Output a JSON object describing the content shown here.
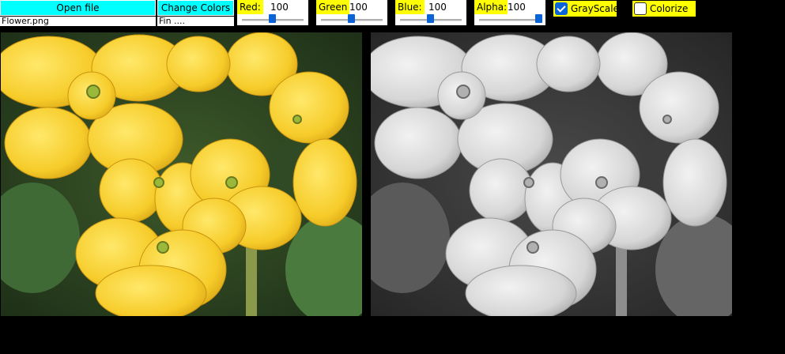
{
  "toolbar": {
    "open_file_label": "Open file",
    "file_name": "Flower.png",
    "change_colors_label": "Change Colors",
    "status_text": "Fin ....",
    "red": {
      "label": "Red:",
      "value": "100",
      "level": 0.5
    },
    "green": {
      "label": "Green",
      "value": "100",
      "level": 0.5
    },
    "blue": {
      "label": "Blue:",
      "value": "100",
      "level": 0.5
    },
    "alpha": {
      "label": "Alpha:",
      "value": "100",
      "level": 1.0
    },
    "grayscale": {
      "label": "GrayScale",
      "checked": true
    },
    "colorize": {
      "label": "Colorize",
      "checked": false
    }
  },
  "colors": {
    "button_bg": "#00ffff",
    "label_bg": "#ffff00",
    "slider_thumb": "#0a64d8",
    "background": "#000000"
  },
  "images": {
    "original": "flower-photo-color",
    "processed": "flower-photo-grayscale"
  }
}
